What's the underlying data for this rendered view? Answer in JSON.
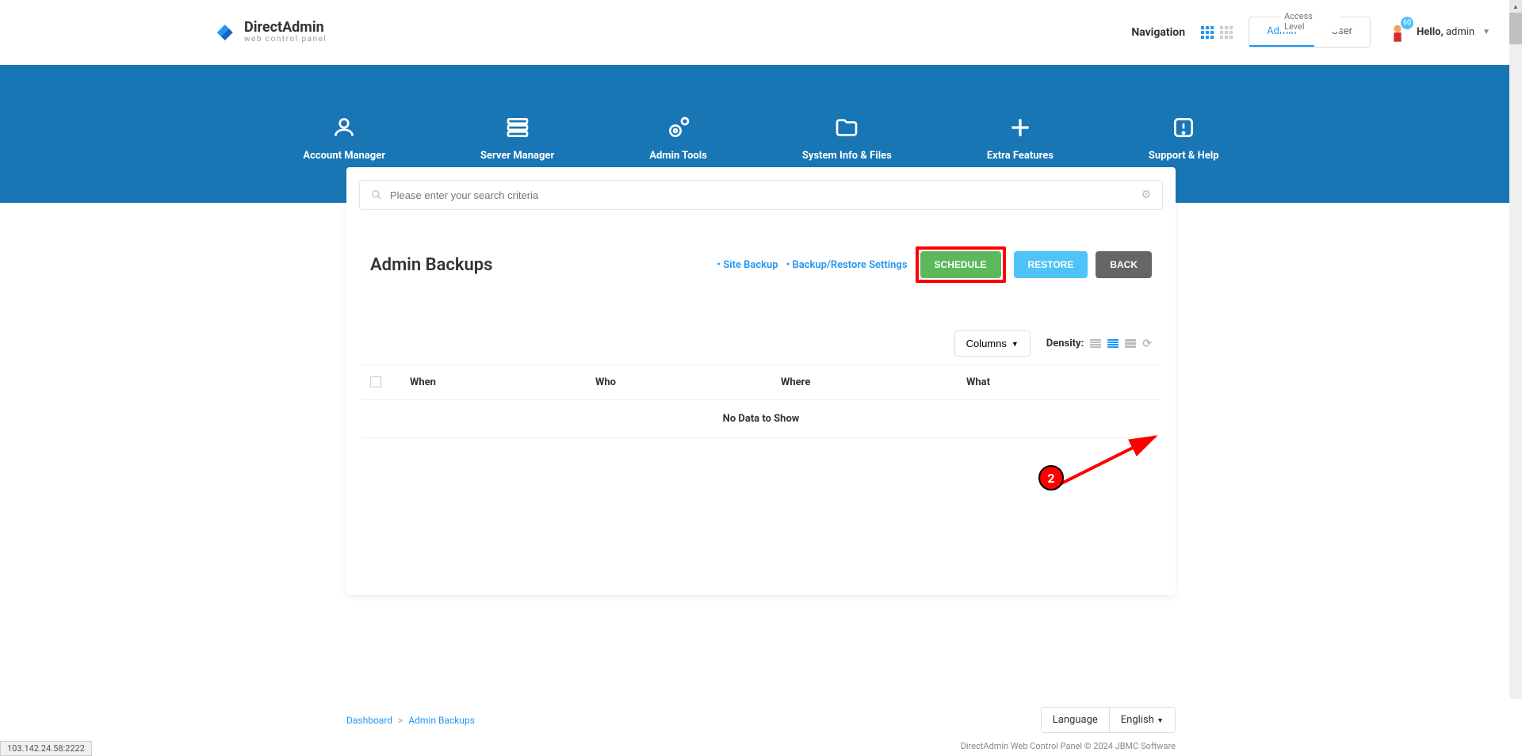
{
  "logo": {
    "name": "DirectAdmin",
    "sub": "web control panel"
  },
  "topbar": {
    "navigation_label": "Navigation",
    "access_level_label": "Access Level",
    "access_admin": "Admin",
    "access_user": "User",
    "badge": "60",
    "hello": "Hello,",
    "username": "admin"
  },
  "nav": [
    {
      "label": "Account Manager"
    },
    {
      "label": "Server Manager"
    },
    {
      "label": "Admin Tools"
    },
    {
      "label": "System Info & Files"
    },
    {
      "label": "Extra Features"
    },
    {
      "label": "Support & Help"
    }
  ],
  "search": {
    "placeholder": "Please enter your search criteria"
  },
  "page": {
    "title": "Admin Backups",
    "link_site_backup": "• Site Backup",
    "link_settings": "• Backup/Restore Settings",
    "btn_schedule": "SCHEDULE",
    "btn_restore": "RESTORE",
    "btn_back": "BACK"
  },
  "table_controls": {
    "columns": "Columns",
    "density": "Density:"
  },
  "table": {
    "col_when": "When",
    "col_who": "Who",
    "col_where": "Where",
    "col_what": "What",
    "no_data": "No Data to Show"
  },
  "breadcrumb": {
    "dashboard": "Dashboard",
    "current": "Admin Backups"
  },
  "footer": {
    "language_label": "Language",
    "language_value": "English",
    "copyright": "DirectAdmin Web Control Panel © 2024 JBMC Software"
  },
  "annotation": {
    "number": "2"
  },
  "status": "103.142.24.58:2222"
}
